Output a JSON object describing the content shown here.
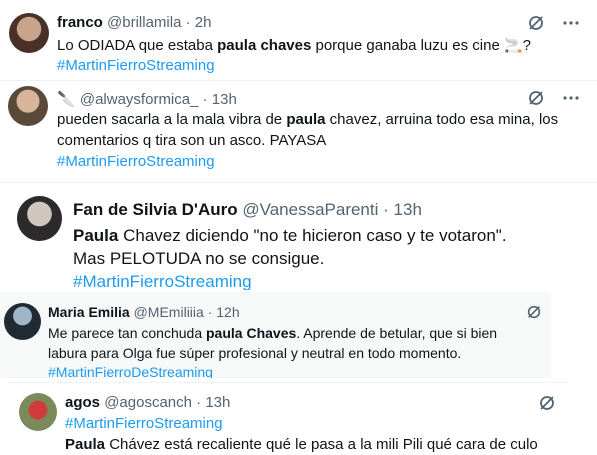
{
  "tweets": [
    {
      "display_name": "franco",
      "handle": "@brillamila",
      "time": "2h",
      "text": [
        {
          "pre": "Lo ODIADA que estaba ",
          "bold": "paula chaves",
          "post": " porque ganaba luzu es cine 🚬?"
        }
      ],
      "hashtag": "#MartinFierroStreaming"
    },
    {
      "display_name": "🔪",
      "handle": "@alwaysformica_",
      "time": "13h",
      "text": [
        {
          "pre": "pueden sacarla a la mala vibra de ",
          "bold": "paula",
          "post": " chavez, arruina todo esa mina, los"
        },
        {
          "pre": "comentarios q tira son un asco. PAYASA",
          "bold": "",
          "post": ""
        }
      ],
      "hashtag": "#MartinFierroStreaming"
    },
    {
      "display_name": "Fan de Silvia D'Auro",
      "handle": "@VanessaParenti",
      "time": "13h",
      "text": [
        {
          "pre": "",
          "bold": "Paula",
          "post": " Chavez diciendo \"no te hicieron caso y te votaron\"."
        },
        {
          "pre": "Mas PELOTUDA no se consigue.",
          "bold": "",
          "post": ""
        }
      ],
      "hashtag": "#MartinFierroStreaming"
    },
    {
      "display_name": "Maria Emilia",
      "handle": "@MEmiliiia",
      "time": "12h",
      "text": [
        {
          "pre": "Me parece tan conchuda ",
          "bold": "paula Chaves",
          "post": ". Aprende de betular, que si bien"
        },
        {
          "pre": "labura para Olga fue súper profesional y neutral en todo momento.",
          "bold": "",
          "post": ""
        }
      ],
      "hashtag": "#MartinFierroDeStreaming"
    },
    {
      "display_name": "agos",
      "handle": "@agoscanch",
      "time": "13h",
      "hashtag": "#MartinFierroStreaming",
      "text": [
        {
          "pre": "",
          "bold": "Paula",
          "post": " Chávez está recaliente qué le pasa a la mili Pili qué cara de culo"
        }
      ]
    }
  ],
  "colors": {
    "accent": "#1d9bf0",
    "muted": "#536471",
    "text": "#0f1419"
  },
  "icons": {
    "grok": "grok-icon",
    "more": "more-options-icon"
  }
}
